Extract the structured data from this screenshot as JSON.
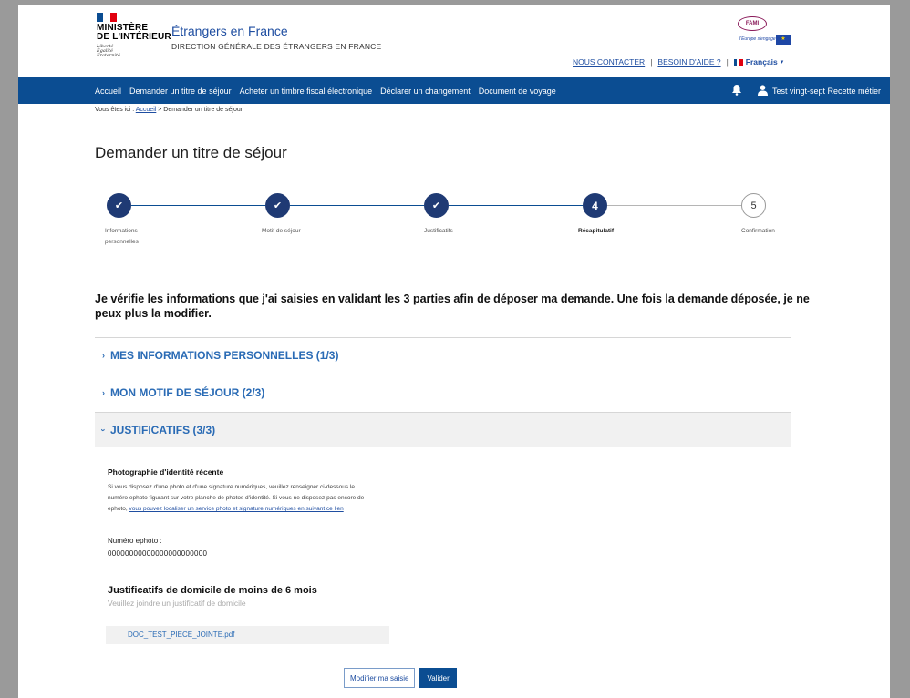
{
  "header": {
    "ministry_line1": "MINISTÈRE",
    "ministry_line2": "DE L'INTÉRIEUR",
    "devise_1": "Liberté",
    "devise_2": "Égalité",
    "devise_3": "Fraternité",
    "site_name": "Étrangers en France",
    "site_subtitle": "DIRECTION GÉNÉRALE DES ÉTRANGERS EN FRANCE",
    "fami_logo": "FAMI",
    "fami_tagline": "l'Europe s'engage",
    "contact_link": "NOUS CONTACTER",
    "help_link": "BESOIN D'AIDE ?",
    "separator": "|",
    "language": "Français",
    "colors": {
      "blue": "#0b4d92",
      "white": "#ffffff",
      "red": "#e1000f"
    }
  },
  "nav": {
    "items": [
      "Accueil",
      "Demander un titre de séjour",
      "Acheter un timbre fiscal électronique",
      "Déclarer un changement",
      "Document de voyage"
    ],
    "user_name": "Test vingt-sept Recette métier",
    "bell_icon": "bell-icon",
    "user_icon": "user-icon"
  },
  "breadcrumb": {
    "prefix": "Vous êtes ici : ",
    "home": "Accueil",
    "current": " > Demander un titre de séjour"
  },
  "page": {
    "title": "Demander un titre de séjour"
  },
  "stepper": {
    "steps": [
      {
        "label1": "Informations",
        "label2": "personnelles",
        "mark": "✔",
        "state": "done"
      },
      {
        "label1": "Motif de séjour",
        "label2": "",
        "mark": "✔",
        "state": "done"
      },
      {
        "label1": "Justificatifs",
        "label2": "",
        "mark": "✔",
        "state": "done"
      },
      {
        "label1": "Récapitulatif",
        "label2": "",
        "mark": "4",
        "state": "current"
      },
      {
        "label1": "Confirmation",
        "label2": "",
        "mark": "5",
        "state": "todo"
      }
    ]
  },
  "intro": "Je vérifie les informations que j'ai saisies en validant les 3 parties afin de déposer ma demande. Une fois la demande déposée, je ne peux plus la modifier.",
  "sections": [
    {
      "title": "MES INFORMATIONS PERSONNELLES (1/3)",
      "chevron": "›",
      "expanded": false
    },
    {
      "title": "MON MOTIF DE SÉJOUR (2/3)",
      "chevron": "›",
      "expanded": false
    },
    {
      "title": "JUSTIFICATIFS (3/3)",
      "chevron": "›",
      "expanded": true
    }
  ],
  "justificatifs": {
    "photo_title": "Photographie d'identité récente",
    "photo_text": "Si vous disposez d'une photo et d'une signature numériques, veuillez renseigner ci-dessous le numéro ephoto figurant sur votre planche de photos d'identité. Si vous ne disposez pas encore de ephoto, ",
    "photo_link": "vous pouvez localiser un service photo et signature numériques en suivant ce lien",
    "ephoto_label": "Numéro ephoto :",
    "ephoto_value": "00000000000000000000000",
    "domicile_title": "Justificatifs de domicile de moins de 6 mois",
    "domicile_subtitle": "Veuillez joindre un justificatif de domicile",
    "file_name": "DOC_TEST_PIECE_JOINTE.pdf"
  },
  "actions": {
    "modify": "Modifier ma saisie",
    "validate": "Valider"
  }
}
